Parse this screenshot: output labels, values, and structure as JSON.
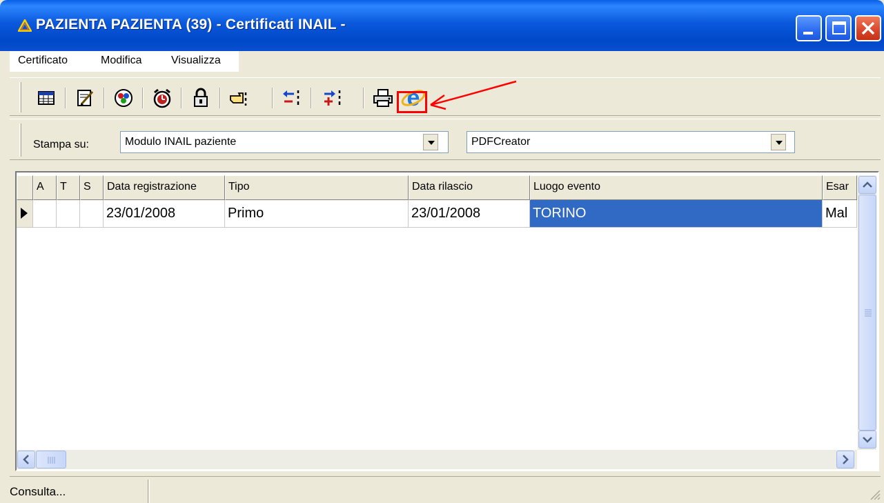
{
  "window": {
    "title": "PAZIENTA PAZIENTA (39) - Certificati INAIL -",
    "title_bar_color": "#0a58dc"
  },
  "menu": {
    "items": [
      "Certificato",
      "Modifica",
      "Visualizza"
    ]
  },
  "toolbar": {
    "icons": [
      "calendar-grid-icon",
      "edit-document-icon",
      "chart-icon",
      "alarm-clock-icon",
      "padlock-icon",
      "pointing-hand-icon",
      "move-left-icon",
      "move-right-icon",
      "printer-icon",
      "internet-explorer-icon"
    ],
    "highlighted_icon": "internet-explorer-icon",
    "highlight_color": "#ff0000"
  },
  "print_bar": {
    "label": "Stampa su:",
    "module_value": "Modulo INAIL paziente",
    "printer_value": "PDFCreator"
  },
  "table": {
    "columns": [
      "A",
      "T",
      "S",
      "Data registrazione",
      "Tipo",
      "Data rilascio",
      "Luogo evento",
      "Esar"
    ],
    "rows": [
      [
        "",
        "",
        "",
        "23/01/2008",
        "Primo",
        "23/01/2008",
        "TORINO",
        "Mal"
      ]
    ],
    "selected_cell": "Luogo evento",
    "selection_color": "#316ac5"
  },
  "status": {
    "text": "Consulta..."
  }
}
